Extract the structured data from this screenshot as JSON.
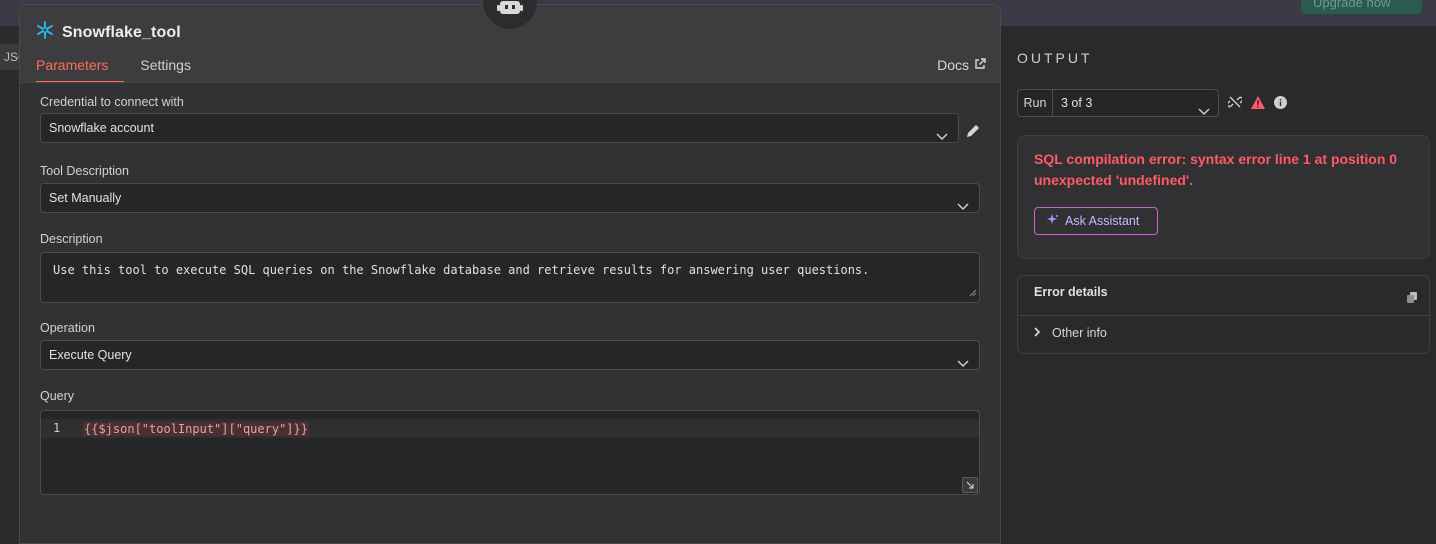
{
  "topbar": {
    "upgrade_label": "Upgrade now"
  },
  "left_tab": {
    "label": "JSC"
  },
  "node": {
    "title": "Snowflake_tool",
    "tabs": [
      {
        "label": "Parameters",
        "active": true
      },
      {
        "label": "Settings",
        "active": false
      }
    ],
    "docs_label": "Docs"
  },
  "fields": {
    "credential": {
      "label": "Credential to connect with",
      "value": "Snowflake account"
    },
    "tool_description": {
      "label": "Tool Description",
      "value": "Set Manually"
    },
    "description": {
      "label": "Description",
      "value": "Use this tool to execute SQL queries on the Snowflake database and retrieve results for answering user questions."
    },
    "operation": {
      "label": "Operation",
      "value": "Execute Query"
    },
    "query": {
      "label": "Query",
      "line_number": "1",
      "code": "{{$json[\"toolInput\"][\"query\"]}}"
    }
  },
  "output": {
    "title": "OUTPUT",
    "run_label": "Run",
    "run_value": "3 of 3",
    "error_message": "SQL compilation error: syntax error line 1 at position 0 unexpected 'undefined'.",
    "ask_assistant_label": "Ask Assistant",
    "error_details_title": "Error details",
    "other_info_label": "Other info"
  },
  "colors": {
    "accent": "#ff6d5a",
    "error": "#ff5a65",
    "assistant_border": "#d05fd7"
  }
}
